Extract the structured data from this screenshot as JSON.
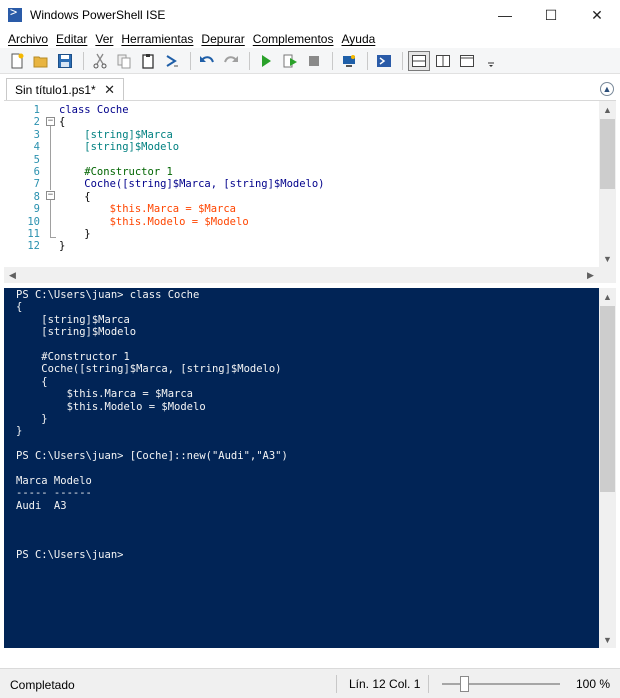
{
  "window": {
    "title": "Windows PowerShell ISE",
    "minimize_glyph": "—",
    "maximize_glyph": "☐",
    "close_glyph": "✕"
  },
  "menu": [
    "Archivo",
    "Editar",
    "Ver",
    "Herramientas",
    "Depurar",
    "Complementos",
    "Ayuda"
  ],
  "toolbar": {
    "icons": [
      "new-file-icon",
      "open-folder-icon",
      "save-icon",
      "cut-icon",
      "copy-icon",
      "paste-icon",
      "clear-console-icon",
      "undo-icon",
      "redo-icon",
      "run-script-icon",
      "run-selection-icon",
      "stop-icon",
      "new-remote-tab-icon",
      "start-powershell-icon",
      "show-script-top-icon",
      "show-script-right-icon",
      "show-script-max-icon",
      "toolbar-overflow-icon"
    ]
  },
  "tab": {
    "label": "Sin título1.ps1*",
    "close_glyph": "✕",
    "collapse_glyph": "▲"
  },
  "editor": {
    "line_numbers": [
      "1",
      "2",
      "3",
      "4",
      "5",
      "6",
      "7",
      "8",
      "9",
      "10",
      "11",
      "12"
    ],
    "lines": [
      "class Coche",
      "{",
      "    [string]$Marca",
      "    [string]$Modelo",
      "",
      "    #Constructor 1",
      "    Coche([string]$Marca, [string]$Modelo)",
      "    {",
      "        $this.Marca = $Marca",
      "        $this.Modelo = $Modelo",
      "    }",
      "}"
    ]
  },
  "console": {
    "lines": [
      "PS C:\\Users\\juan> class Coche",
      "{",
      "    [string]$Marca",
      "    [string]$Modelo",
      "",
      "    #Constructor 1",
      "    Coche([string]$Marca, [string]$Modelo)",
      "    {",
      "        $this.Marca = $Marca",
      "        $this.Modelo = $Modelo",
      "    }",
      "}",
      "",
      "PS C:\\Users\\juan> [Coche]::new(\"Audi\",\"A3\")",
      "",
      "Marca Modelo",
      "----- ------",
      "Audi  A3",
      "",
      "",
      "",
      "PS C:\\Users\\juan> "
    ]
  },
  "status": {
    "state": "Completado",
    "position": "Lín. 12  Col. 1",
    "zoom": "100 %",
    "zoom_level_percent": 100
  },
  "colors": {
    "console_bg": "#012456",
    "line_number": "#2b91af",
    "keyword": "#00008b",
    "type": "#008080",
    "variable": "#ff4500",
    "comment": "#006400"
  }
}
